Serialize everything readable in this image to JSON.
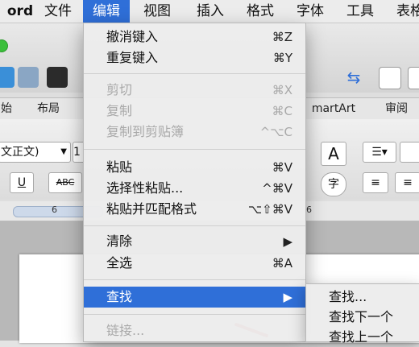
{
  "menubar": {
    "app": "ord",
    "items": [
      "文件",
      "编辑",
      "视图",
      "插入",
      "格式",
      "字体",
      "工具",
      "表格"
    ]
  },
  "ribbon": {
    "tabs": [
      "始",
      "布局",
      "martArt",
      "审阅"
    ],
    "font_name": "文正文)",
    "font_size_partial": "1",
    "ruler_marks": [
      "6",
      "6"
    ],
    "underline": "U",
    "strike": "ABC",
    "text_style_A": "A",
    "phonetic": "字"
  },
  "edit_menu": {
    "items": [
      {
        "label": "撤消键入",
        "shortcut": "⌘Z",
        "enabled": true
      },
      {
        "label": "重复键入",
        "shortcut": "⌘Y",
        "enabled": true
      },
      {
        "label": "剪切",
        "shortcut": "⌘X",
        "enabled": false
      },
      {
        "label": "复制",
        "shortcut": "⌘C",
        "enabled": false
      },
      {
        "label": "复制到剪贴簿",
        "shortcut": "^⌥C",
        "enabled": false
      },
      {
        "label": "粘贴",
        "shortcut": "⌘V",
        "enabled": true
      },
      {
        "label": "选择性粘贴...",
        "shortcut": "^⌘V",
        "enabled": true
      },
      {
        "label": "粘贴并匹配格式",
        "shortcut": "⌥⇧⌘V",
        "enabled": true
      },
      {
        "label": "清除",
        "shortcut": "▶",
        "enabled": true
      },
      {
        "label": "全选",
        "shortcut": "⌘A",
        "enabled": true
      },
      {
        "label": "查找",
        "shortcut": "▶",
        "enabled": true,
        "selected": true
      },
      {
        "label": "链接...",
        "shortcut": "",
        "enabled": false
      }
    ]
  },
  "find_submenu": {
    "items": [
      "查找...",
      "查找下一个",
      "查找上一个"
    ]
  },
  "colors": {
    "accent": "#2f6fd8",
    "annotation": "#d8292f"
  }
}
